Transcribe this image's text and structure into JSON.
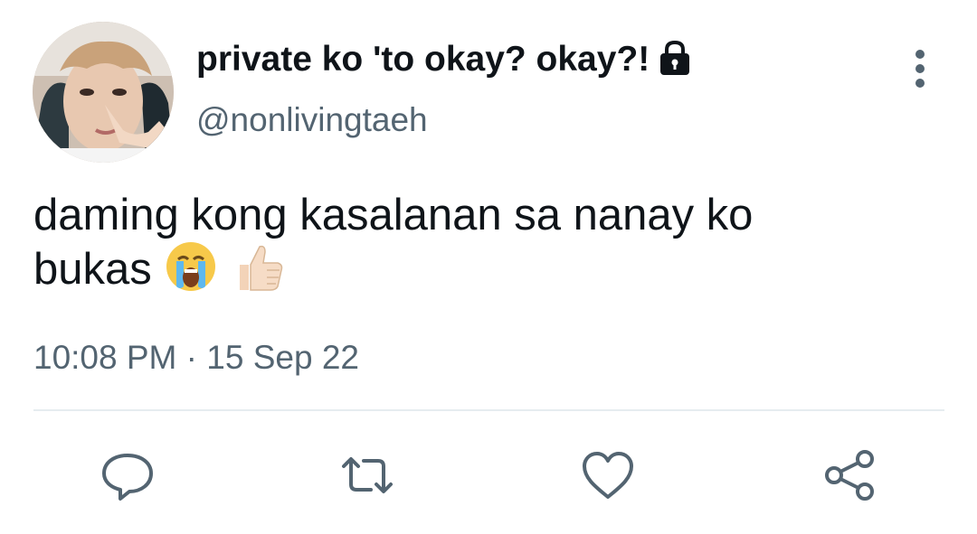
{
  "tweet": {
    "author": {
      "display_name": "private ko 'to okay? okay?!",
      "handle": "@nonlivingtaeh",
      "avatar_icon": "avatar-photo",
      "protected_icon": "lock-icon"
    },
    "text_line1": "daming kong kasalanan sa nanay ko",
    "text_line2": "bukas",
    "emojis": [
      "loudly-crying-face-emoji",
      "thumbs-up-emoji"
    ],
    "time": "10:08 PM",
    "separator": "·",
    "date": "15 Sep 22"
  },
  "actions": [
    {
      "name": "reply",
      "icon": "reply-icon"
    },
    {
      "name": "retweet",
      "icon": "retweet-icon"
    },
    {
      "name": "like",
      "icon": "heart-icon"
    },
    {
      "name": "share",
      "icon": "share-icon"
    }
  ],
  "colors": {
    "primary_text": "#0f1419",
    "secondary_text": "#536471",
    "divider": "#e6ecf0",
    "icon": "#536471"
  }
}
